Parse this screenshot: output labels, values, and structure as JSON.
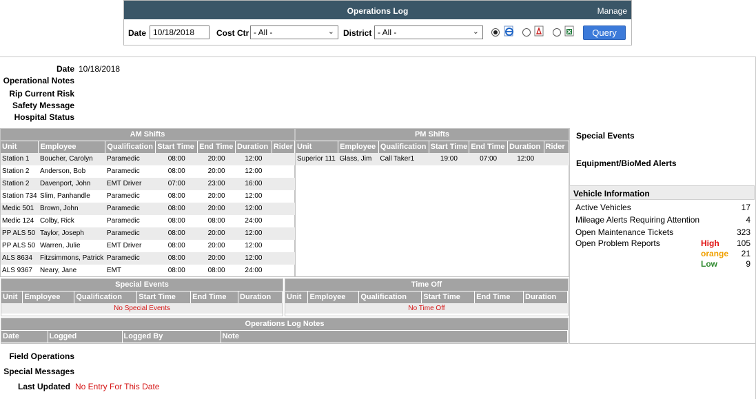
{
  "top": {
    "title": "Operations Log",
    "manage_label": "Manage",
    "date_label": "Date",
    "date_value": "10/18/2018",
    "cost_ctr_label": "Cost Ctr",
    "cost_ctr_value": "- All -",
    "district_label": "District",
    "district_value": "- All -",
    "export_options": [
      "ie-icon",
      "pdf-icon",
      "excel-icon"
    ],
    "selected_export": 0,
    "query_label": "Query"
  },
  "info": {
    "date_label": "Date",
    "date_value": "10/18/2018",
    "operational_notes_label": "Operational Notes",
    "rip_current_label": "Rip Current Risk",
    "safety_message_label": "Safety Message",
    "hospital_status_label": "Hospital Status"
  },
  "am_shifts": {
    "title": "AM Shifts",
    "columns": [
      "Unit",
      "Employee",
      "Qualification",
      "Start Time",
      "End Time",
      "Duration",
      "Rider"
    ],
    "rows": [
      [
        "Station 1",
        "Boucher, Carolyn",
        "Paramedic",
        "08:00",
        "20:00",
        "12:00",
        ""
      ],
      [
        "Station 2",
        "Anderson, Bob",
        "Paramedic",
        "08:00",
        "20:00",
        "12:00",
        ""
      ],
      [
        "Station 2",
        "Davenport, John",
        "EMT Driver",
        "07:00",
        "23:00",
        "16:00",
        ""
      ],
      [
        "Station 734",
        "Slim, Panhandle",
        "Paramedic",
        "08:00",
        "20:00",
        "12:00",
        ""
      ],
      [
        "Medic 501",
        "Brown, John",
        "Paramedic",
        "08:00",
        "20:00",
        "12:00",
        ""
      ],
      [
        "Medic 124",
        "Colby, Rick",
        "Paramedic",
        "08:00",
        "08:00",
        "24:00",
        ""
      ],
      [
        "PP ALS 50",
        "Taylor, Joseph",
        "Paramedic",
        "08:00",
        "20:00",
        "12:00",
        ""
      ],
      [
        "PP ALS 50",
        "Warren, Julie",
        "EMT Driver",
        "08:00",
        "20:00",
        "12:00",
        ""
      ],
      [
        "ALS 8634",
        "Fitzsimmons, Patrick",
        "Paramedic",
        "08:00",
        "20:00",
        "12:00",
        ""
      ],
      [
        "ALS 9367",
        "Neary, Jane",
        "EMT",
        "08:00",
        "08:00",
        "24:00",
        ""
      ]
    ]
  },
  "pm_shifts": {
    "title": "PM Shifts",
    "columns": [
      "Unit",
      "Employee",
      "Qualification",
      "Start Time",
      "End Time",
      "Duration",
      "Rider"
    ],
    "rows": [
      [
        "Superior 111",
        "Glass, Jim",
        "Call Taker1",
        "19:00",
        "07:00",
        "12:00",
        ""
      ]
    ]
  },
  "special_events_grid": {
    "title": "Special Events",
    "columns": [
      "Unit",
      "Employee",
      "Qualification",
      "Start Time",
      "End Time",
      "Duration"
    ],
    "empty_text": "No Special Events"
  },
  "time_off_grid": {
    "title": "Time Off",
    "columns": [
      "Unit",
      "Employee",
      "Qualification",
      "Start Time",
      "End Time",
      "Duration"
    ],
    "empty_text": "No Time Off"
  },
  "log_notes": {
    "title": "Operations Log Notes",
    "columns": [
      "Date",
      "Logged",
      "Logged By",
      "Note"
    ]
  },
  "right": {
    "special_events_label": "Special Events",
    "equipment_label": "Equipment/BioMed Alerts",
    "vehicle_info_label": "Vehicle Information",
    "active_vehicles_label": "Active Vehicles",
    "active_vehicles_value": "17",
    "mileage_label": "Mileage Alerts Requiring Attention",
    "mileage_value": "4",
    "maintenance_label": "Open Maintenance Tickets",
    "maintenance_value": "323",
    "problem_label": "Open Problem Reports",
    "problem_levels": [
      {
        "level": "High",
        "count": "105",
        "color": "#e01010"
      },
      {
        "level": "orange",
        "count": "21",
        "color": "#f0a000"
      },
      {
        "level": "Low",
        "count": "9",
        "color": "#2f8a2f"
      }
    ]
  },
  "bottom": {
    "field_ops_label": "Field Operations",
    "special_messages_label": "Special Messages",
    "last_updated_label": "Last Updated",
    "last_updated_value": "No Entry For This Date"
  }
}
